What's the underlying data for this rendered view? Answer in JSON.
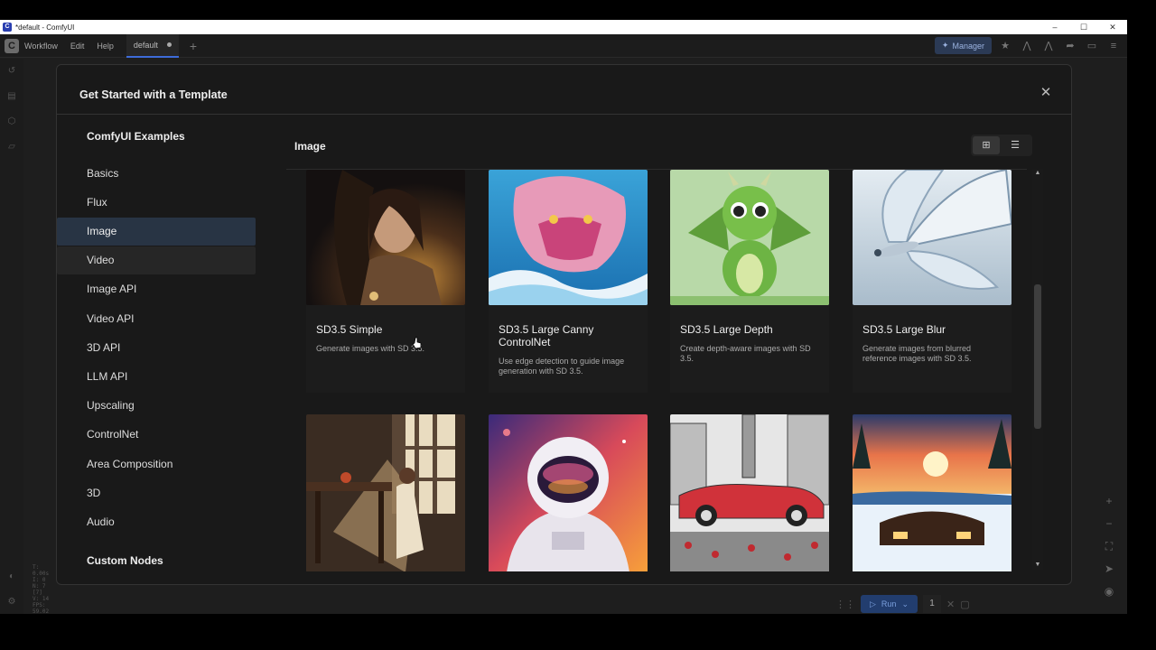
{
  "window": {
    "title": "*default - ComfyUI",
    "app_icon_letter": "C",
    "controls": [
      "–",
      "☐",
      "✕"
    ]
  },
  "menubar": {
    "items": [
      "Workflow",
      "Edit",
      "Help"
    ],
    "tab_label": "default",
    "manager_label": "Manager"
  },
  "stats": [
    "T: 0.00s",
    "I: 0",
    "N: 7 [7]",
    "V: 14",
    "FPS: 59.02"
  ],
  "run": {
    "label": "Run",
    "count": "1"
  },
  "dialog": {
    "title": "Get Started with a Template",
    "nav": {
      "heading": "ComfyUI Examples",
      "items": [
        "Basics",
        "Flux",
        "Image",
        "Video",
        "Image API",
        "Video API",
        "3D API",
        "LLM API",
        "Upscaling",
        "ControlNet",
        "Area Composition",
        "3D",
        "Audio"
      ],
      "active": "Image",
      "hovered": "Video",
      "heading2": "Custom Nodes"
    },
    "section_title": "Image",
    "view_mode": "grid",
    "cards": [
      {
        "title": "SD3.5 Simple",
        "desc": "Generate images with SD 3.5."
      },
      {
        "title": "SD3.5 Large Canny ControlNet",
        "desc": "Use edge detection to guide image generation with SD 3.5."
      },
      {
        "title": "SD3.5 Large Depth",
        "desc": "Create depth-aware images with SD 3.5."
      },
      {
        "title": "SD3.5 Large Blur",
        "desc": "Generate images from blurred reference images with SD 3.5."
      },
      {
        "title": "",
        "desc": ""
      },
      {
        "title": "",
        "desc": ""
      },
      {
        "title": "",
        "desc": ""
      },
      {
        "title": "",
        "desc": ""
      }
    ]
  },
  "colors": {
    "accent": "#3d6bd8",
    "dialog_bg": "#191919",
    "nav_active": "#283444"
  }
}
